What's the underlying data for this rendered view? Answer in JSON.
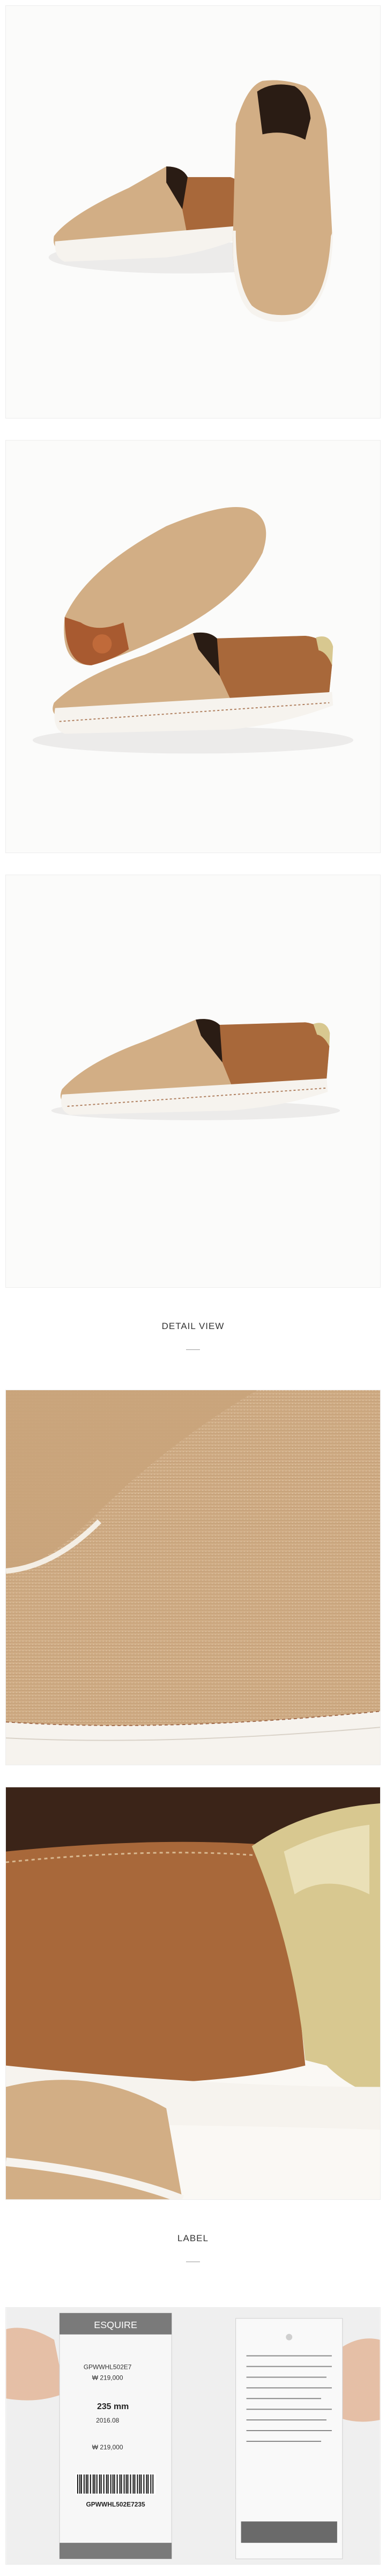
{
  "sections": {
    "detail_title": "DETAIL VIEW",
    "label_title": "LABEL"
  },
  "label_tag": {
    "brand": "ESQUIRE",
    "code_header": "GPWWHL502E7",
    "price_header": "₩ 219,000",
    "size": "235 mm",
    "date": "2016.08",
    "model_footer": "GPWWHL502E7235",
    "price_footer": "₩ 219,000"
  },
  "colors": {
    "canvas_tan": "#d2ae85",
    "leather_brown": "#a8683a",
    "gold_heel": "#d8c890",
    "sole_white": "#f6f3ee",
    "border_gray": "#ededed"
  }
}
